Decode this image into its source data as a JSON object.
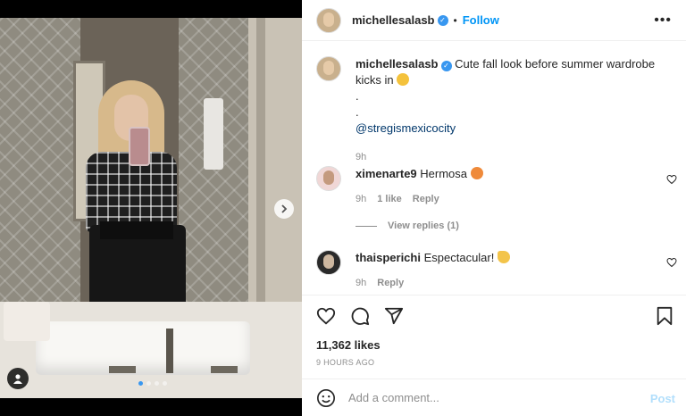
{
  "post": {
    "username": "michellesalasb",
    "follow_label": "Follow",
    "separator": "•",
    "more_label": "•••",
    "caption": {
      "username": "michellesalasb",
      "text": "Cute fall look before summer wardrobe kicks in",
      "dot1": ".",
      "dot2": ".",
      "mention": "@stregismexicocity",
      "time": "9h"
    }
  },
  "comments": [
    {
      "username": "ximenarte9",
      "text": "Hermosa",
      "time": "9h",
      "likes": "1 like",
      "reply": "Reply",
      "view_replies": "View replies (1)"
    },
    {
      "username": "thaisperichi",
      "text": "Espectacular!",
      "time": "9h",
      "reply": "Reply"
    }
  ],
  "actions": {
    "likes": "11,362 likes",
    "timestamp": "9 HOURS AGO"
  },
  "composer": {
    "placeholder": "Add a comment...",
    "post_label": "Post"
  },
  "carousel": {
    "slide_index": 1,
    "slide_count": 4
  },
  "icons": [
    "heart-icon",
    "comment-icon",
    "share-icon",
    "save-icon",
    "emoji-icon",
    "chevron-right-icon",
    "user-tag-icon",
    "verified-badge-icon",
    "more-options-icon"
  ],
  "colors": {
    "accent": "#0095f6",
    "post_disabled": "#b2dffc",
    "muted": "#8e8e8e"
  }
}
